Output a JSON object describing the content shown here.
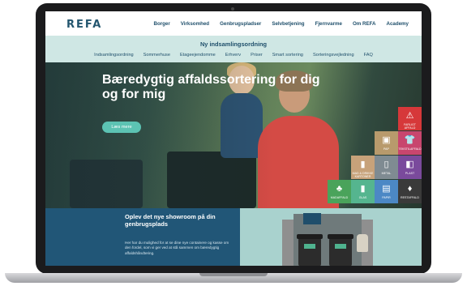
{
  "brand": {
    "logo_text": "REFA"
  },
  "main_nav": [
    "Borger",
    "Virksomhed",
    "Genbrugspladser",
    "Selvbetjening",
    "Fjernvarme",
    "Om REFA",
    "Academy"
  ],
  "sub_header": {
    "title": "Ny indsamlingsordning",
    "items": [
      "Indsamlingsordning",
      "Sommerhuse",
      "Etageejendomme",
      "Erhverv",
      "Priser",
      "Smart sortering",
      "Sorteringsvejledning",
      "FAQ"
    ]
  },
  "hero": {
    "headline": "Bæredygtig affaldssortering for dig og for mig",
    "cta_label": "Læs mere"
  },
  "waste_tiles": [
    {
      "label": "FARLIGT AFFALD",
      "icon": "warning-icon",
      "color": "#d6383a"
    },
    {
      "label": "TEKSTILAFFALD",
      "icon": "shirt-icon",
      "color": "#c8466e"
    },
    {
      "label": "PAP",
      "icon": "box-icon",
      "color": "#b89a6c"
    },
    {
      "label": "MAD & DRIKKE KARTONER",
      "icon": "carton-icon",
      "color": "#c7a27a"
    },
    {
      "label": "METAL",
      "icon": "can-icon",
      "color": "#7f8b92"
    },
    {
      "label": "PLAST",
      "icon": "bottle-icon",
      "color": "#7a4a9c"
    },
    {
      "label": "MADAFFALD",
      "icon": "apple-icon",
      "color": "#4aa35b"
    },
    {
      "label": "GLAS",
      "icon": "glass-bottle-icon",
      "color": "#55b58f"
    },
    {
      "label": "PAPIR",
      "icon": "paper-icon",
      "color": "#4c88c5"
    },
    {
      "label": "RESTAFFALD",
      "icon": "trash-bag-icon",
      "color": "#3a3a3a"
    }
  ],
  "showroom": {
    "title": "Oplev det nye showroom på din genbrugsplads",
    "text": "Her har du mulighed for at se dine nye containere og kasse om den fordel, som vi ger ved at stå sammen om bæredygtig affaldshåndtering."
  }
}
